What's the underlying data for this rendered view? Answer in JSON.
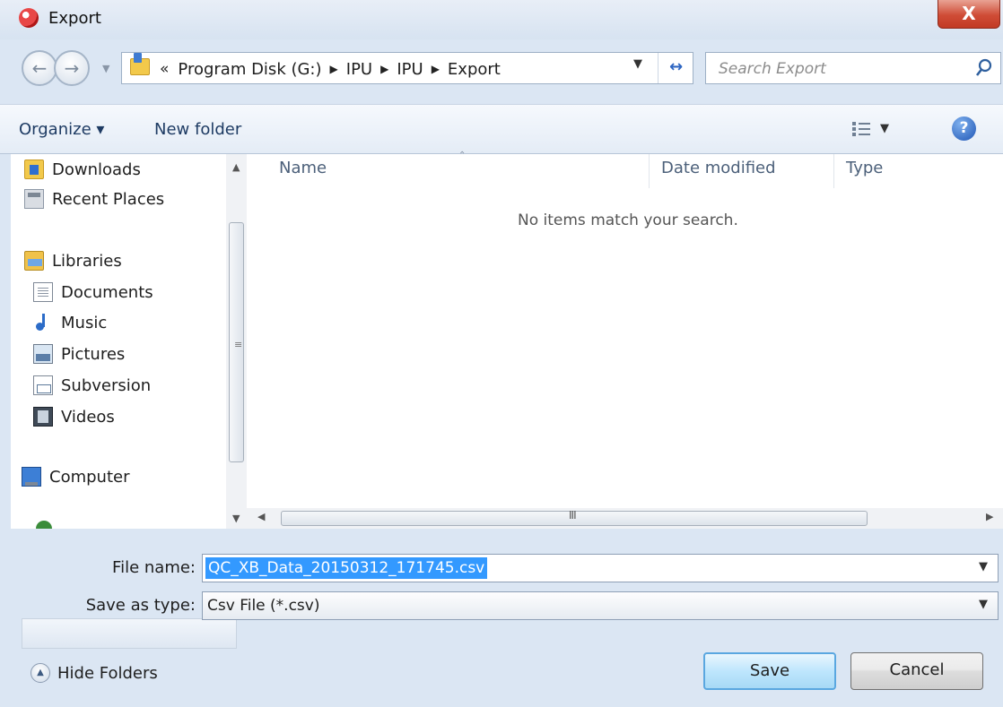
{
  "window": {
    "title": "Export",
    "close_glyph": "X"
  },
  "navigation": {
    "breadcrumb_overflow": "«",
    "breadcrumbs": [
      "Program Disk (G:)",
      "IPU",
      "IPU",
      "Export"
    ],
    "search_placeholder": "Search Export",
    "icons": {
      "back": "back-arrow-icon",
      "forward": "forward-arrow-icon",
      "refresh": "refresh-icon",
      "search": "search-icon"
    }
  },
  "toolbar": {
    "organize_label": "Organize ▾",
    "new_folder_label": "New folder",
    "help_glyph": "?"
  },
  "nav_pane": {
    "items": [
      {
        "label": "Downloads",
        "icon": "downloads-icon"
      },
      {
        "label": "Recent Places",
        "icon": "recent-places-icon"
      },
      {
        "label": "Libraries",
        "icon": "libraries-icon"
      },
      {
        "label": "Documents",
        "icon": "documents-icon"
      },
      {
        "label": "Music",
        "icon": "music-icon"
      },
      {
        "label": "Pictures",
        "icon": "pictures-icon"
      },
      {
        "label": "Subversion",
        "icon": "subversion-icon"
      },
      {
        "label": "Videos",
        "icon": "videos-icon"
      },
      {
        "label": "Computer",
        "icon": "computer-icon"
      }
    ],
    "selected": "Computer"
  },
  "file_list": {
    "columns": [
      "Name",
      "Date modified",
      "Type"
    ],
    "empty_message": "No items match your search.",
    "hscroll_grip": "III"
  },
  "form": {
    "file_name_label": "File name:",
    "file_name_value": "QC_XB_Data_20150312_171745.csv",
    "save_type_label": "Save as type:",
    "save_type_value": "Csv File (*.csv)"
  },
  "footer": {
    "hide_folders_label": "Hide Folders",
    "save_label": "Save",
    "cancel_label": "Cancel"
  },
  "colors": {
    "selection": "#3399ff",
    "window_frame": "#dbe6f3",
    "close_button": "#c23a24",
    "link_text": "#1e3b63"
  }
}
